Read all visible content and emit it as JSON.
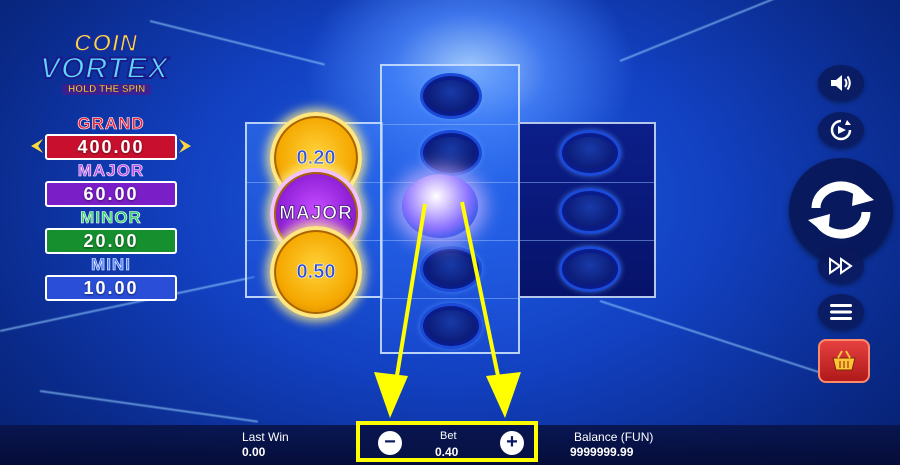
{
  "game": {
    "logo_line1": "COIN",
    "logo_line2": "VORTEX",
    "logo_line3": "HOLD THE SPIN"
  },
  "jackpots": [
    {
      "name": "GRAND",
      "value": "400.00",
      "name_color": "#e8233a",
      "box_color": "#c8102e"
    },
    {
      "name": "MAJOR",
      "value": "60.00",
      "name_color": "#c04cf0",
      "box_color": "#7a1ec8"
    },
    {
      "name": "MINOR",
      "value": "20.00",
      "name_color": "#35d86a",
      "box_color": "#16902e"
    },
    {
      "name": "MINI",
      "value": "10.00",
      "name_color": "#4a7cff",
      "box_color": "#2a4ed8"
    }
  ],
  "reels": {
    "coin_values": [
      "0.20",
      "MAJOR",
      "0.50"
    ]
  },
  "bottom_bar": {
    "last_win_label": "Last Win",
    "last_win_value": "0.00",
    "bet_label": "Bet",
    "bet_value": "0.40",
    "balance_label": "Balance (FUN)",
    "balance_value": "9999999.99"
  },
  "icons": {
    "sound": "speaker-icon",
    "autoplay": "autoplay-icon",
    "spin": "spin-icon",
    "turbo": "fast-forward-icon",
    "menu": "menu-icon",
    "buy": "basket-icon",
    "bet_minus": "minus-icon",
    "bet_plus": "plus-icon"
  },
  "colors": {
    "highlight": "#ffff00",
    "coin_gold": "#f5a800",
    "major_purple": "#8e1fd6"
  }
}
